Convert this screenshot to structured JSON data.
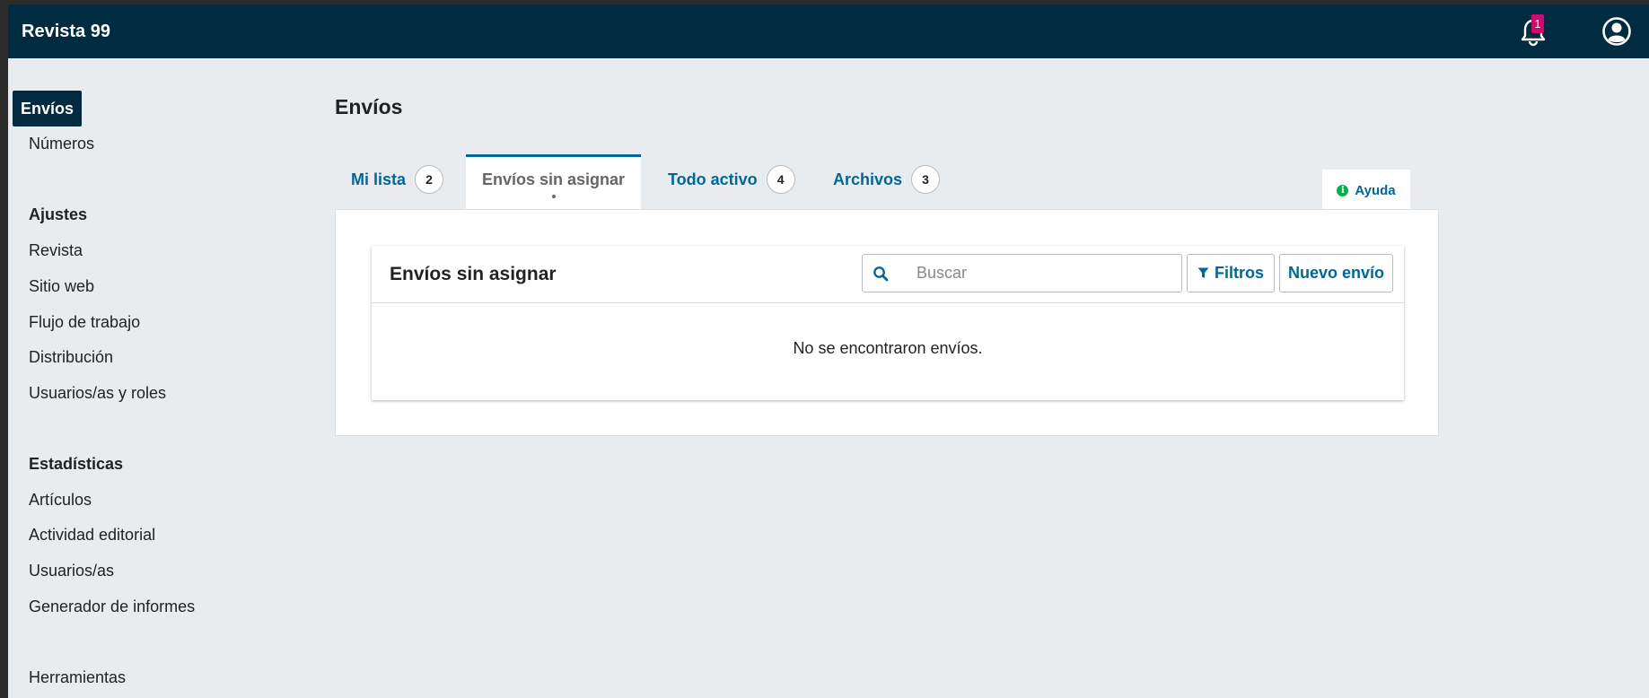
{
  "header": {
    "site_name": "Revista 99",
    "notifications_count": "1"
  },
  "sidebar": {
    "items": [
      {
        "label": "Envíos"
      },
      {
        "label": "Números"
      }
    ],
    "settings": {
      "heading": "Ajustes",
      "items": [
        {
          "label": "Revista"
        },
        {
          "label": "Sitio web"
        },
        {
          "label": "Flujo de trabajo"
        },
        {
          "label": "Distribución"
        },
        {
          "label": "Usuarios/as y roles"
        }
      ]
    },
    "stats": {
      "heading": "Estadísticas",
      "items": [
        {
          "label": "Artículos"
        },
        {
          "label": "Actividad editorial"
        },
        {
          "label": "Usuarios/as"
        },
        {
          "label": "Generador de informes"
        }
      ]
    },
    "tools": {
      "label": "Herramientas"
    }
  },
  "main": {
    "title": "Envíos",
    "tabs": [
      {
        "label": "Mi lista",
        "count": "2"
      },
      {
        "label": "Envíos sin asignar"
      },
      {
        "label": "Todo activo",
        "count": "4"
      },
      {
        "label": "Archivos",
        "count": "3"
      }
    ],
    "help_label": "Ayuda",
    "list": {
      "title": "Envíos sin asignar",
      "search_placeholder": "Buscar",
      "filters_label": "Filtros",
      "new_label": "Nuevo envío",
      "empty_message": "No se encontraron envíos."
    }
  },
  "colors": {
    "header_bg": "#002b40",
    "link": "#006798",
    "badge": "#d00a6c",
    "info": "#00b24e"
  }
}
